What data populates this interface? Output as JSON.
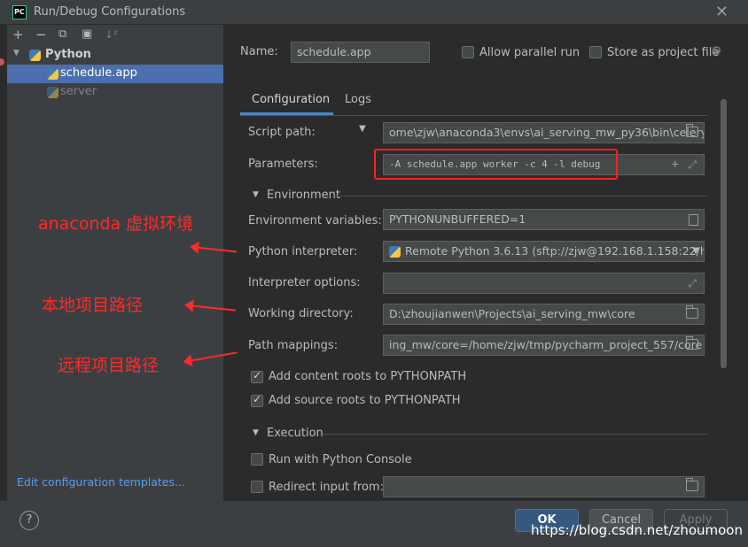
{
  "window": {
    "title": "Run/Debug Configurations",
    "app_icon_text": "PC"
  },
  "left": {
    "toolbar": [
      "+",
      "−",
      "⧉",
      "▣",
      "↓²"
    ],
    "tree": [
      {
        "label": "Python",
        "bold": true,
        "expanded": true
      },
      {
        "label": "schedule.app",
        "selected": true
      },
      {
        "label": "server",
        "dimmed": true
      }
    ],
    "edit_templates": "Edit configuration templates..."
  },
  "annotations": [
    "anaconda 虚拟环境",
    "本地项目路径",
    "远程项目路径"
  ],
  "form": {
    "name_label": "Name:",
    "name_value": "schedule.app",
    "allow_parallel": "Allow parallel run",
    "store_project": "Store as project file",
    "tabs": [
      "Configuration",
      "Logs"
    ],
    "script_path_label": "Script path:",
    "script_path": "ome\\zjw\\anaconda3\\envs\\ai_serving_mw_py36\\bin\\celery",
    "parameters_label": "Parameters:",
    "parameters": "-A schedule.app worker -c 4 -l debug",
    "environment_section": "Environment",
    "env_vars_label": "Environment variables:",
    "env_vars": "PYTHONUNBUFFERED=1",
    "interpreter_label": "Python interpreter:",
    "interpreter": "Remote Python 3.6.13 (sftp://zjw@192.168.1.158:22/ho",
    "interp_options_label": "Interpreter options:",
    "interp_options": "",
    "working_dir_label": "Working directory:",
    "working_dir": "D:\\zhoujianwen\\Projects\\ai_serving_mw\\core",
    "path_mappings_label": "Path mappings:",
    "path_mappings": "ing_mw/core=/home/zjw/tmp/pycharm_project_557/core",
    "add_content_roots": "Add content roots to PYTHONPATH",
    "add_source_roots": "Add source roots to PYTHONPATH",
    "execution_section": "Execution",
    "run_with_console": "Run with Python Console",
    "redirect_input": "Redirect input from:"
  },
  "buttons": {
    "help": "?",
    "ok": "OK",
    "cancel": "Cancel",
    "apply": "Apply"
  },
  "watermark": "https://blog.csdn.net/zhoumoon",
  "colors": {
    "accent": "#4b6eaf",
    "annotation_red": "#ff2a2a",
    "background": "#3c3f41"
  }
}
